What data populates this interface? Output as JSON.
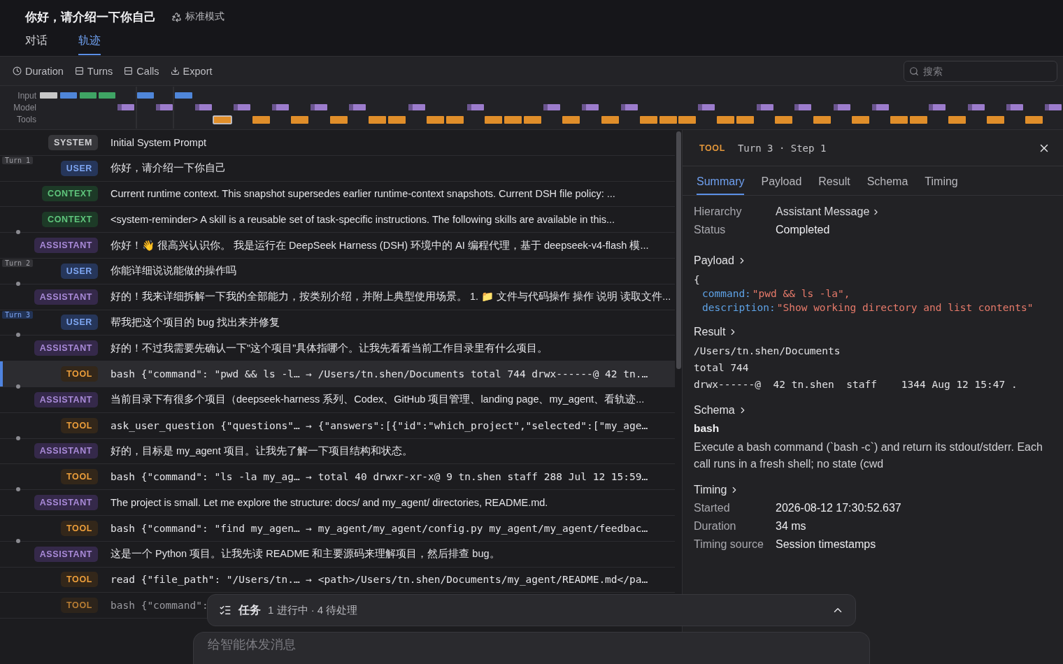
{
  "header": {
    "title": "你好，请介绍一下你自己",
    "mode": "标准模式"
  },
  "tabs": [
    {
      "label": "对话",
      "selected": false
    },
    {
      "label": "轨迹",
      "selected": true
    }
  ],
  "toolbar": {
    "buttons": [
      {
        "kind": "duration",
        "label": "Duration"
      },
      {
        "kind": "turns",
        "label": "Turns"
      },
      {
        "kind": "calls",
        "label": "Calls"
      },
      {
        "kind": "export",
        "label": "Export"
      }
    ],
    "search": {
      "placeholder": "搜索"
    }
  },
  "timeline": {
    "lanes": [
      "Input",
      "Model",
      "Tools"
    ]
  },
  "rows": [
    {
      "kind": "system",
      "badge": "SYSTEM",
      "text": "Initial System Prompt",
      "selected": false
    },
    {
      "kind": "user",
      "badge": "USER",
      "text": "你好，请介绍一下你自己",
      "selected": false,
      "turn": {
        "label": "Turn 1",
        "selected": false
      }
    },
    {
      "kind": "context",
      "badge": "CONTEXT",
      "text": "Current runtime context. This snapshot supersedes earlier runtime-context snapshots. Current DSH file policy: ...",
      "selected": false
    },
    {
      "kind": "context",
      "badge": "CONTEXT",
      "text": "<system-reminder> A skill is a reusable set of task-specific instructions. The following skills are available in this...",
      "selected": false
    },
    {
      "kind": "assistant",
      "badge": "ASSISTANT",
      "text": "你好！👋 很高兴认识你。 我是运行在 DeepSeek Harness (DSH) 环境中的 AI 编程代理，基于 deepseek-v4-flash 模...",
      "selected": false
    },
    {
      "kind": "user",
      "badge": "USER",
      "text": "你能详细说说能做的操作吗",
      "selected": false,
      "turn": {
        "label": "Turn 2",
        "selected": false
      }
    },
    {
      "kind": "assistant",
      "badge": "ASSISTANT",
      "text": "好的！我来详细拆解一下我的全部能力，按类别介绍，并附上典型使用场景。 1. 📁 文件与代码操作 操作 说明 读取文件...",
      "selected": false
    },
    {
      "kind": "user",
      "badge": "USER",
      "text": "帮我把这个项目的 bug 找出来并修复",
      "selected": false,
      "turn": {
        "label": "Turn 3",
        "selected": true
      }
    },
    {
      "kind": "assistant",
      "badge": "ASSISTANT",
      "text": "好的！不过我需要先确认一下\"这个项目\"具体指哪个。让我先看看当前工作目录里有什么项目。",
      "selected": false
    },
    {
      "kind": "tool",
      "badge": "TOOL",
      "text": "bash {\"command\": \"pwd && ls -l… → /Users/tn.shen/Documents total 744 drwx------@ 42 tn.…",
      "selected": true
    },
    {
      "kind": "assistant",
      "badge": "ASSISTANT",
      "text": "当前目录下有很多个项目（deepseek-harness 系列、Codex、GitHub 项目管理、landing page、my_agent、看轨迹...",
      "selected": false
    },
    {
      "kind": "tool",
      "badge": "TOOL",
      "text": "ask_user_question {\"questions\"… → {\"answers\":[{\"id\":\"which_project\",\"selected\":[\"my_age…",
      "selected": false
    },
    {
      "kind": "assistant",
      "badge": "ASSISTANT",
      "text": "好的，目标是 my_agent 项目。让我先了解一下项目结构和状态。",
      "selected": false
    },
    {
      "kind": "tool",
      "badge": "TOOL",
      "text": "bash {\"command\": \"ls -la my_ag… → total 40 drwxr-xr-x@ 9 tn.shen staff 288 Jul 12 15:59…",
      "selected": false
    },
    {
      "kind": "assistant",
      "badge": "ASSISTANT",
      "text": "The project is small. Let me explore the structure: docs/ and my_agent/ directories, README.md.",
      "selected": false
    },
    {
      "kind": "tool",
      "badge": "TOOL",
      "text": "bash {\"command\": \"find my_agen… → my_agent/my_agent/config.py my_agent/my_agent/feedbac…",
      "selected": false
    },
    {
      "kind": "assistant",
      "badge": "ASSISTANT",
      "text": "这是一个 Python 项目。让我先读 README 和主要源码来理解项目，然后排查 bug。",
      "selected": false
    },
    {
      "kind": "tool",
      "badge": "TOOL",
      "text": "read {\"file_path\": \"/Users/tn.… → <path>/Users/tn.shen/Documents/my_agent/README.md</pa…",
      "selected": false
    },
    {
      "kind": "tool",
      "badge": "TOOL",
      "text": "bash {\"command\":",
      "selected": false,
      "faded": true
    }
  ],
  "detail": {
    "badge": "TOOL",
    "step": "Turn 3 · Step 1",
    "tabs": [
      {
        "label": "Summary",
        "selected": true
      },
      {
        "label": "Payload",
        "selected": false
      },
      {
        "label": "Result",
        "selected": false
      },
      {
        "label": "Schema",
        "selected": false
      },
      {
        "label": "Timing",
        "selected": false
      }
    ],
    "summary": [
      {
        "label": "Hierarchy",
        "value": "Assistant Message",
        "link": true
      },
      {
        "label": "Status",
        "value": "Completed",
        "link": false
      }
    ],
    "payload": {
      "title": "Payload",
      "open": "{",
      "fields": [
        {
          "key": "command:",
          "value": "\"pwd && ls -la\","
        },
        {
          "key": "description:",
          "value": "\"Show working directory and list contents\""
        }
      ]
    },
    "result": {
      "title": "Result",
      "lines": [
        "/Users/tn.shen/Documents",
        "total 744",
        "drwx------@  42 tn.shen  staff    1344 Aug 12 15:47 ."
      ]
    },
    "schema": {
      "title": "Schema",
      "name": "bash",
      "description": "Execute a bash command (`bash -c`) and return its stdout/stderr. Each call runs in a fresh shell; no state (cwd"
    },
    "timing": {
      "title": "Timing",
      "fields": [
        {
          "label": "Started",
          "value": "2026-08-12 17:30:52.637"
        },
        {
          "label": "Duration",
          "value": "34 ms"
        },
        {
          "label": "Timing source",
          "value": "Session timestamps"
        }
      ]
    }
  },
  "tasks": {
    "title": "任务",
    "status": "1 进行中 · 4 待处理"
  },
  "composer": {
    "placeholder": "给智能体发消息"
  }
}
